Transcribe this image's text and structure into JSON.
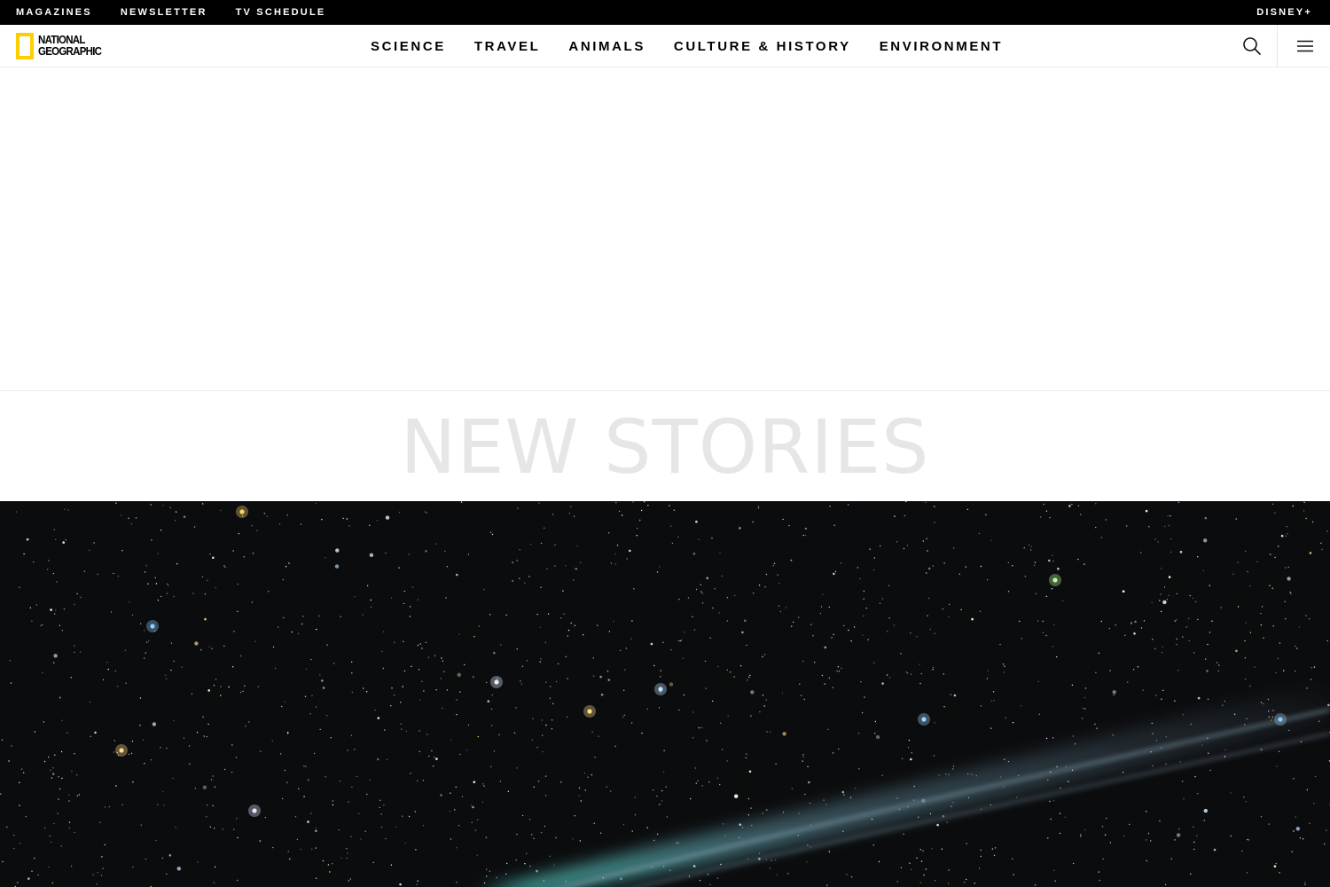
{
  "utility_bar": {
    "links": [
      "MAGAZINES",
      "NEWSLETTER",
      "TV SCHEDULE"
    ],
    "right_link": "DISNEY+"
  },
  "header": {
    "logo": {
      "line1": "NATIONAL",
      "line2": "GEOGRAPHIC",
      "frame_color": "#ffce00"
    },
    "nav": [
      "SCIENCE",
      "TRAVEL",
      "ANIMALS",
      "CULTURE & HISTORY",
      "ENVIRONMENT"
    ],
    "icons": [
      "search-icon",
      "hamburger-menu-icon"
    ]
  },
  "section": {
    "title": "NEW STORIES"
  },
  "hero": {
    "image": "starfield-with-comet-tail",
    "colors": {
      "sky": "#0b0c0e",
      "comet_tail": "#5fb8c0"
    }
  }
}
